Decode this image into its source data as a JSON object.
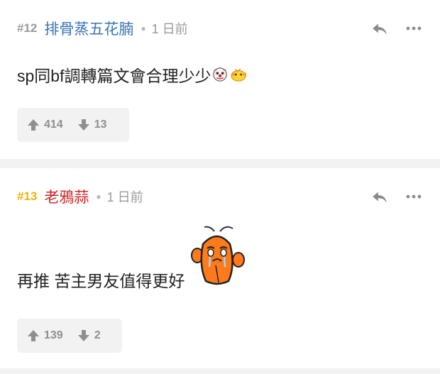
{
  "posts": [
    {
      "number": "#12",
      "number_color": "#9a9a9a",
      "author": "排骨蒸五花腩",
      "author_color": "#3974b6",
      "time": "1 日前",
      "text": "sp同bf調轉篇文會合理少少",
      "emoji": [
        "clown-face-icon",
        "duck-icon"
      ],
      "upvotes": "414",
      "downvotes": "13"
    },
    {
      "number": "#13",
      "number_color": "#f0b400",
      "author": "老鴉蒜",
      "author_color": "#cc2222",
      "time": "1 日前",
      "text": "再推 苦主男友值得更好",
      "emoji": [
        "crying-shrimp-sticker-icon"
      ],
      "upvotes": "139",
      "downvotes": "2"
    }
  ]
}
